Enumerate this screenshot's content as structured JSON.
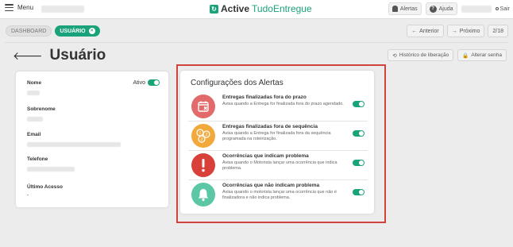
{
  "topbar": {
    "menu_label": "Menu",
    "brand_bold": "Active",
    "brand_light": "TudoEntregue",
    "alerts_label": "Alertas",
    "help_label": "Ajuda",
    "logout_label": "Sair",
    "brand_color": "#1aa37a"
  },
  "breadcrumbs": {
    "dashboard": "DASHBOARD",
    "current": "USUÁRIO",
    "previous_label": "Anterior",
    "next_label": "Próximo",
    "page_counter": "2/18"
  },
  "page": {
    "title": "Usuário",
    "history_button": "Histórico de liberação",
    "change_password_button": "Alterar senha"
  },
  "user": {
    "fields": [
      {
        "label": "Nome"
      },
      {
        "label": "Sobrenome"
      },
      {
        "label": "Email"
      },
      {
        "label": "Telefone"
      },
      {
        "label": "Último Acesso",
        "value": "-"
      }
    ],
    "active_label": "Ativo",
    "active": true
  },
  "alerts": {
    "title": "Configurações dos Alertas",
    "items": [
      {
        "title": "Entregas finalizadas fora do prazo",
        "description": "Avisa quando a Entrega for finalizada fora do prazo agendado.",
        "icon": "calendar-x-icon",
        "icon_color": "#e36a6a",
        "enabled": true
      },
      {
        "title": "Entregas finalizadas fora de sequência",
        "description": "Avisa quando a Entrega for finalizada fora da sequência programada na roteirização.",
        "icon": "sequence-numbers-icon",
        "icon_color": "#f2a93b",
        "enabled": true
      },
      {
        "title": "Ocorrências que indicam problema",
        "description": "Avisa quando o Motorista lançar uma ocorrência que indica problema.",
        "icon": "exclamation-icon",
        "icon_color": "#d9403a",
        "enabled": true
      },
      {
        "title": "Ocorrências que não indicam problema",
        "description": "Avisa quando o motorista lançar uma ocorrência que não é finalizadora e não indica problema.",
        "icon": "bell-icon",
        "icon_color": "#5cc7a6",
        "enabled": true
      }
    ]
  }
}
